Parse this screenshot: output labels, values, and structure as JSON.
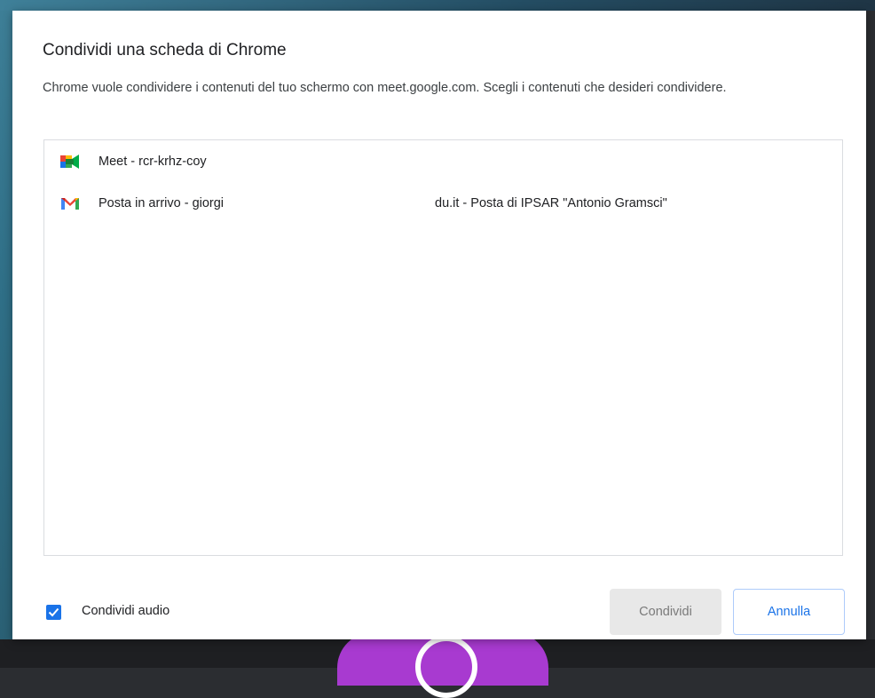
{
  "dialog": {
    "title": "Condividi una scheda di Chrome",
    "description": "Chrome vuole condividere i contenuti del tuo schermo con meet.google.com. Scegli i contenuti che desideri condividere."
  },
  "tabs": [
    {
      "label": "Meet - rcr-krhz-coy",
      "icon": "google-meet-icon"
    },
    {
      "label": "Posta in arrivo - giorgi",
      "label_end": "du.it - Posta di IPSAR \"Antonio Gramsci\"",
      "icon": "gmail-icon"
    }
  ],
  "audio": {
    "label": "Condividi audio",
    "checked": true
  },
  "buttons": {
    "share": "Condividi",
    "cancel": "Annulla"
  },
  "colors": {
    "accent": "#1a73e8",
    "disabled_bg": "#e8e8e8"
  }
}
